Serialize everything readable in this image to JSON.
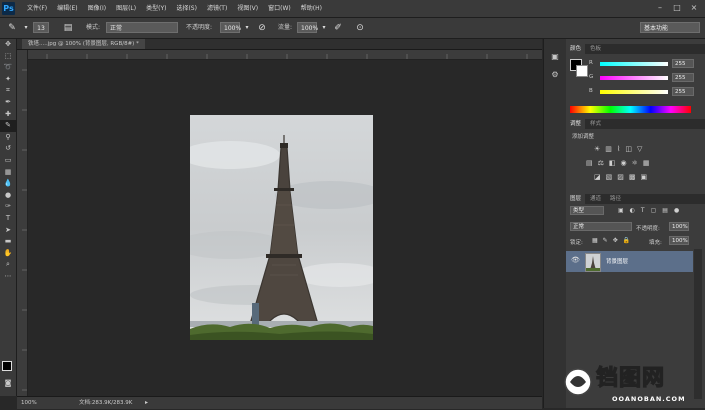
{
  "app": {
    "logo": "Ps"
  },
  "menu": [
    "文件(F)",
    "编辑(E)",
    "图像(I)",
    "图层(L)",
    "类型(Y)",
    "选择(S)",
    "滤镜(T)",
    "视图(V)",
    "窗口(W)",
    "帮助(H)"
  ],
  "window_controls": [
    "–",
    "□",
    "×"
  ],
  "options": {
    "brush_size": "13",
    "mode_label": "模式:",
    "mode_value": "正常",
    "opacity_label": "不透明度:",
    "opacity_value": "100%",
    "flow_label": "流量:",
    "flow_value": "100%",
    "workspace": "基本功能"
  },
  "document": {
    "tab_title": "铁塔.....jpg @ 100% (背景图层, RGB/8#) *",
    "zoom": "100%",
    "doc_info": "文档:283.9K/283.9K"
  },
  "color_panel": {
    "tabs": [
      "颜色",
      "色板"
    ],
    "channels": [
      {
        "label": "R",
        "value": "255"
      },
      {
        "label": "G",
        "value": "255"
      },
      {
        "label": "B",
        "value": "255"
      }
    ]
  },
  "adjustments_panel": {
    "tabs": [
      "调整",
      "样式"
    ],
    "title": "添加调整"
  },
  "layers_panel": {
    "tabs": [
      "图层",
      "通道",
      "路径"
    ],
    "filter_label": "类型",
    "blend_mode": "正常",
    "opacity_label": "不透明度:",
    "opacity_value": "100%",
    "lock_label": "锁定:",
    "fill_label": "填充:",
    "fill_value": "100%",
    "layer_name": "背景图层"
  },
  "watermark": {
    "brand": "铛图网",
    "url": "OOANOBAN.COM"
  },
  "colors": {
    "accent": "#5c6f8a",
    "ps_blue": "#31a8ff"
  }
}
